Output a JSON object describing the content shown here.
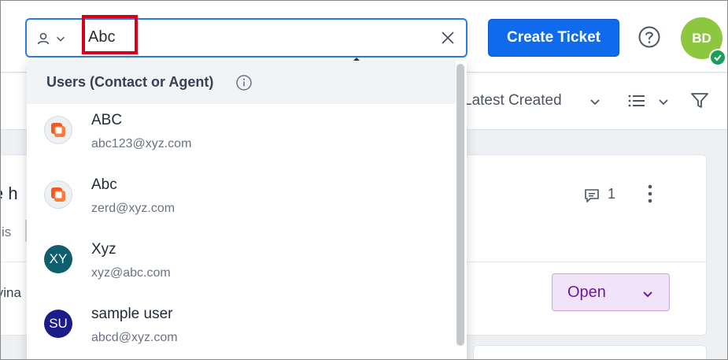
{
  "header": {
    "search_value": "Abc",
    "create_button_label": "Create Ticket",
    "user_initials": "BD",
    "colors": {
      "accent": "#0f6bec",
      "avatar_bg": "#8dc63f",
      "online": "#1a9e5c"
    }
  },
  "toolbar": {
    "sort_label": "Latest Created"
  },
  "dropdown": {
    "section_title": "Users (Contact or Agent)",
    "items": [
      {
        "name": "ABC",
        "email": "abc123@xyz.com",
        "avatar_type": "logo-icon",
        "initials": ""
      },
      {
        "name": "Abc",
        "email": "zerd@xyz.com",
        "avatar_type": "logo-icon",
        "initials": ""
      },
      {
        "name": "Xyz",
        "email": "xyz@abc.com",
        "avatar_type": "initials",
        "initials": "XY",
        "avatar_color": "#0f5e6d"
      },
      {
        "name": "sample user",
        "email": "abcd@xyz.com",
        "avatar_type": "initials",
        "initials": "SU",
        "avatar_color": "#1b1b8a"
      }
    ]
  },
  "ticket_card": {
    "title_fragment": "e h",
    "subtitle_fragment": "is",
    "name_fragment": "ivina",
    "comment_count": "1",
    "status": "Open",
    "status_color": "#6a1b9a"
  }
}
